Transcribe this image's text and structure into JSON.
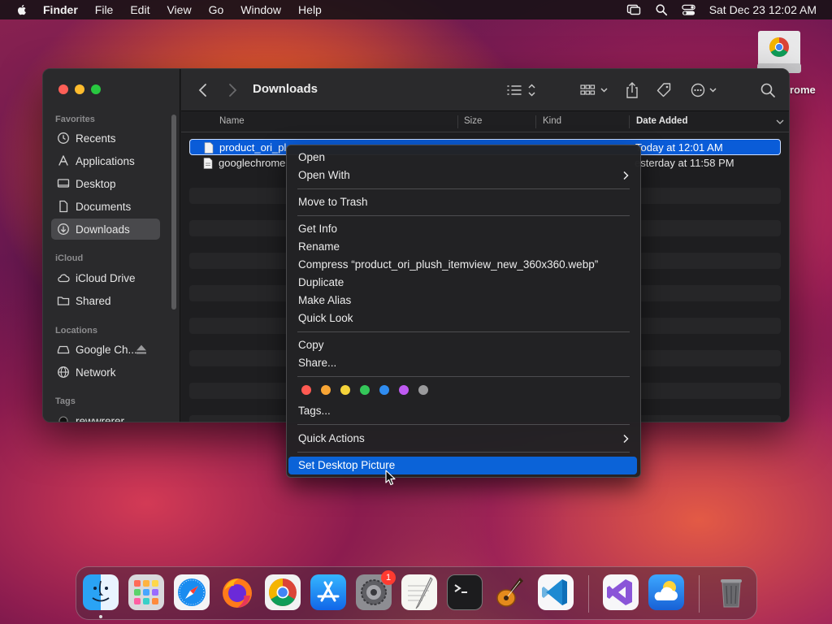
{
  "menubar": {
    "items": [
      "Finder",
      "File",
      "Edit",
      "View",
      "Go",
      "Window",
      "Help"
    ],
    "clock": "Sat Dec 23  12:02 AM"
  },
  "desktop": {
    "drive_label": "rome"
  },
  "finder": {
    "title": "Downloads",
    "sidebar": {
      "favorites_head": "Favorites",
      "favorites": [
        "Recents",
        "Applications",
        "Desktop",
        "Documents",
        "Downloads"
      ],
      "icloud_head": "iCloud",
      "icloud": [
        "iCloud Drive",
        "Shared"
      ],
      "locations_head": "Locations",
      "locations": [
        "Google Ch...",
        "Network"
      ],
      "tags_head": "Tags",
      "tags": [
        "rewwrerer"
      ]
    },
    "columns": {
      "name": "Name",
      "size": "Size",
      "kind": "Kind",
      "date": "Date Added"
    },
    "files": [
      {
        "name": "product_ori_pl",
        "date": "Today at 12:01 AM"
      },
      {
        "name": "googlechrome",
        "date": "esterday at 11:58 PM"
      }
    ]
  },
  "context_menu": {
    "open": "Open",
    "open_with": "Open With",
    "move_to_trash": "Move to Trash",
    "get_info": "Get Info",
    "rename": "Rename",
    "compress": "Compress “product_ori_plush_itemview_new_360x360.webp”",
    "duplicate": "Duplicate",
    "make_alias": "Make Alias",
    "quick_look": "Quick Look",
    "copy": "Copy",
    "share": "Share...",
    "tags": "Tags...",
    "quick_actions": "Quick Actions",
    "set_desktop_picture": "Set Desktop Picture",
    "tag_colors": [
      "#ff5a52",
      "#f8a535",
      "#f5d33a",
      "#34c759",
      "#2f8cf0",
      "#bf5af2",
      "#9a9a9c"
    ]
  },
  "dock": {
    "apps": [
      "finder",
      "launchpad",
      "safari",
      "firefox",
      "chrome",
      "app-store",
      "system-settings",
      "textedit",
      "terminal",
      "garageband",
      "vscode",
      "visual-studio",
      "weather",
      "trash"
    ],
    "settings_badge": "1"
  }
}
